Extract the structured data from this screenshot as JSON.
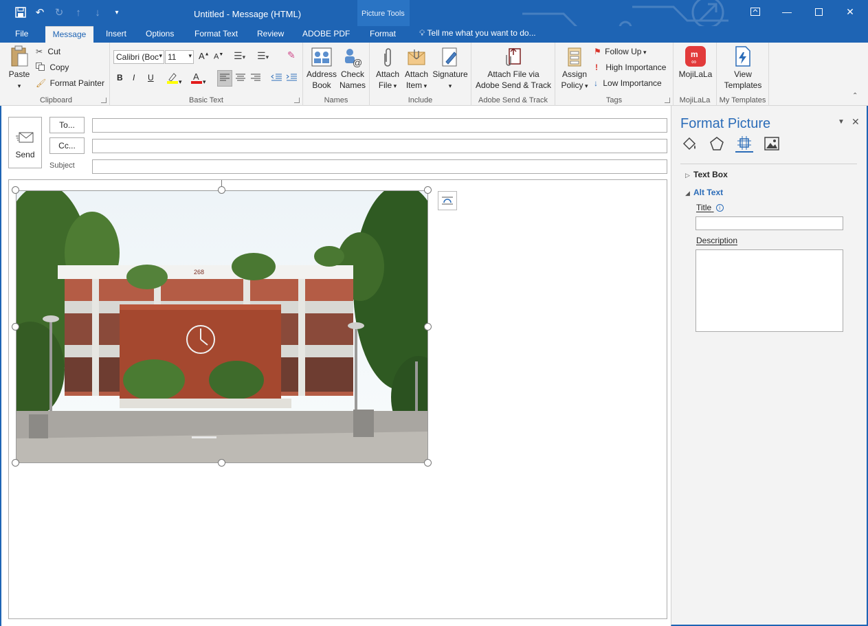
{
  "window": {
    "title": "Untitled - Message (HTML)",
    "contextual_group": "Picture Tools"
  },
  "tabs": [
    {
      "label": "File"
    },
    {
      "label": "Message"
    },
    {
      "label": "Insert"
    },
    {
      "label": "Options"
    },
    {
      "label": "Format Text"
    },
    {
      "label": "Review"
    },
    {
      "label": "ADOBE PDF"
    },
    {
      "label": "Format"
    }
  ],
  "tell_me": "Tell me what you want to do...",
  "ribbon": {
    "clipboard": {
      "label": "Clipboard",
      "paste": "Paste",
      "cut": "Cut",
      "copy": "Copy",
      "format_painter": "Format Painter"
    },
    "basic_text": {
      "label": "Basic Text",
      "font": "Calibri (Boc",
      "size": "11",
      "bold": "B",
      "italic": "I",
      "underline": "U"
    },
    "names": {
      "label": "Names",
      "address_book_1": "Address",
      "address_book_2": "Book",
      "check_names_1": "Check",
      "check_names_2": "Names"
    },
    "include": {
      "label": "Include",
      "attach_file_1": "Attach",
      "attach_file_2": "File",
      "attach_item_1": "Attach",
      "attach_item_2": "Item",
      "signature": "Signature"
    },
    "adobe": {
      "label": "Adobe Send & Track",
      "btn_1": "Attach File via",
      "btn_2": "Adobe Send & Track"
    },
    "tags": {
      "label": "Tags",
      "assign_1": "Assign",
      "assign_2": "Policy",
      "follow_up": "Follow Up",
      "high": "High Importance",
      "low": "Low Importance"
    },
    "mojilala": {
      "label": "MojiLaLa",
      "btn": "MojiLaLa"
    },
    "templates": {
      "label": "My Templates",
      "btn_1": "View",
      "btn_2": "Templates"
    }
  },
  "compose": {
    "send": "Send",
    "to": "To...",
    "cc": "Cc...",
    "subject": "Subject"
  },
  "photo": {
    "building_number": "268"
  },
  "pane": {
    "title": "Format Picture",
    "section_text_box": "Text Box",
    "section_alt_text": "Alt Text",
    "title_label": "Title",
    "description_label": "Description"
  },
  "colors": {
    "accent": "#1e64b4",
    "pane_heading": "#2b6cb8",
    "flag": "#d9342b"
  }
}
